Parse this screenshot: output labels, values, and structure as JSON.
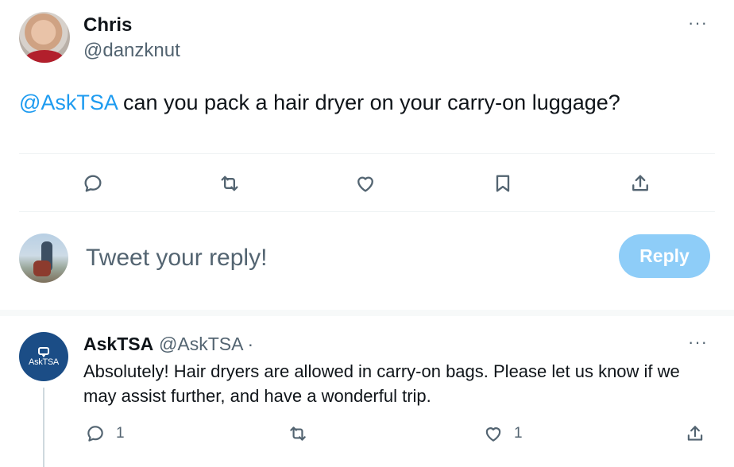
{
  "main_tweet": {
    "author_name": "Chris",
    "author_handle": "@danzknut",
    "more_label": "···",
    "mention": "@AskTSA",
    "text": " can you pack a hair dryer on your carry-on luggage?"
  },
  "composer": {
    "placeholder": "Tweet your reply!",
    "reply_button": "Reply"
  },
  "reply_tweet": {
    "author_name": "AskTSA",
    "author_handle": "@AskTSA ·",
    "avatar_label": "AskTSA",
    "more_label": "···",
    "text": "Absolutely! Hair dryers are allowed in carry-on bags. Please let us know if we may assist further, and have a wonderful trip.",
    "reply_count": "1",
    "like_count": "1"
  },
  "icons": [
    "reply-icon",
    "retweet-icon",
    "like-icon",
    "bookmark-icon",
    "share-icon",
    "more-icon"
  ],
  "colors": {
    "accent": "#1d9bf0",
    "reply_button_disabled": "#8ecdf8",
    "secondary_text": "#536471",
    "tsa_blue": "#1b4d86"
  }
}
